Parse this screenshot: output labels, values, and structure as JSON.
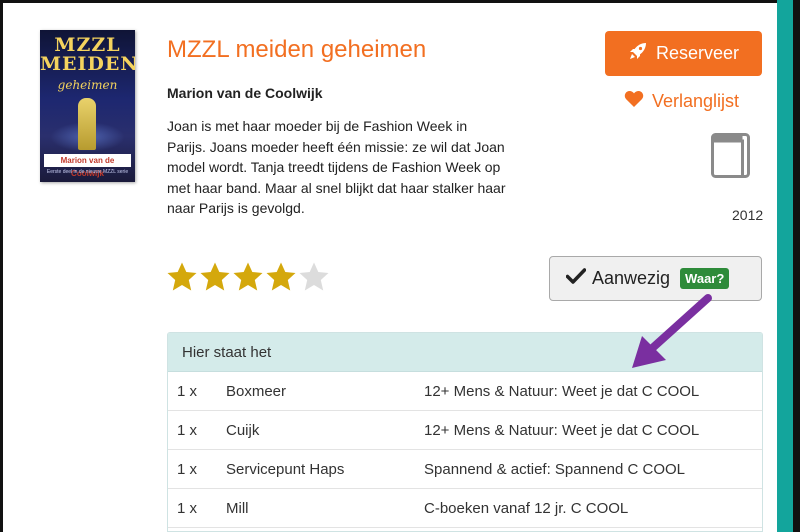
{
  "book": {
    "title": "MZZL meiden geheimen",
    "author": "Marion van de Coolwijk",
    "description": "Joan is met haar moeder bij de Fashion Week in Parijs. Joans moeder heeft één missie: ze wil dat Joan model wordt. Tanja treedt tijdens de Fashion Week op met haar band. Maar al snel blijkt dat haar stalker haar naar Parijs is gevolgd.",
    "rating": 4,
    "rating_max": 5,
    "year": "2012",
    "format_icon": "book-icon"
  },
  "cover": {
    "title_line1": "MZZL",
    "title_line2": "MEIDEN",
    "subtitle": "geheimen",
    "author": "Marion van de Coolwijk",
    "footer": "Eerste deel in de nieuwe MZZL serie"
  },
  "actions": {
    "reserve_label": "Reserveer",
    "reserve_icon": "rocket-icon",
    "wishlist_label": "Verlanglijst",
    "wishlist_icon": "heart-icon",
    "availability_label": "Aanwezig",
    "availability_icon": "check-icon",
    "where_badge": "Waar?"
  },
  "locations": {
    "heading": "Hier staat het",
    "rows": [
      {
        "count": "1 x",
        "place": "Boxmeer",
        "shelf": "12+ Mens & Natuur: Weet je dat C COOL"
      },
      {
        "count": "1 x",
        "place": "Cuijk",
        "shelf": "12+ Mens & Natuur: Weet je dat C COOL"
      },
      {
        "count": "1 x",
        "place": "Servicepunt Haps",
        "shelf": "Spannend & actief: Spannend C COOL"
      },
      {
        "count": "1 x",
        "place": "Mill",
        "shelf": "C-boeken vanaf 12 jr. C COOL"
      }
    ]
  },
  "colors": {
    "accent_orange": "#f26f21",
    "star_gold": "#d4a80c",
    "star_empty": "#dcdcdc",
    "available_green": "#2e8b3a",
    "annotation_arrow": "#7a2fa0",
    "panel_header": "#d4ebea",
    "side_bar": "#13a59c"
  }
}
